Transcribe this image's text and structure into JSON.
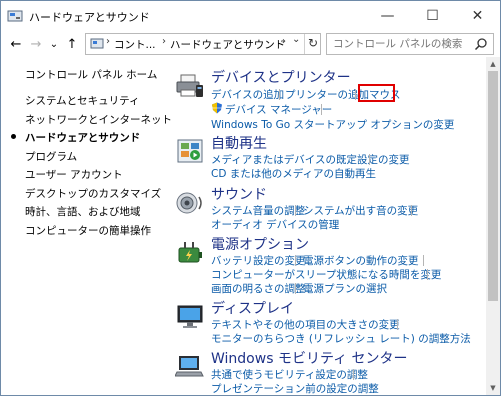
{
  "window": {
    "title": "ハードウェアとサウンド",
    "minimize_glyph": "—",
    "maximize_glyph": "☐",
    "close_glyph": "✕"
  },
  "nav": {
    "back_glyph": "←",
    "forward_glyph": "→",
    "recent_glyph": "⌄",
    "up_glyph": "↑",
    "refresh_glyph": "↻",
    "dropdown_glyph": "⌄"
  },
  "address": {
    "crumbs": [
      "コント...",
      "ハードウェアとサウンド"
    ],
    "separator": "›"
  },
  "search": {
    "placeholder": "コントロール パネルの検索"
  },
  "sidebar": {
    "home": "コントロール パネル ホーム",
    "items": [
      {
        "label": "システムとセキュリティ"
      },
      {
        "label": "ネットワークとインターネット"
      },
      {
        "label": "ハードウェアとサウンド",
        "active": true
      },
      {
        "label": "プログラム"
      },
      {
        "label": "ユーザー アカウント"
      },
      {
        "label": "デスクトップのカスタマイズ"
      },
      {
        "label": "時計、言語、および地域"
      },
      {
        "label": "コンピューターの簡単操作"
      }
    ]
  },
  "categories": {
    "devices": {
      "title": "デバイスとプリンター",
      "links": [
        "デバイスの追加",
        "プリンターの追加",
        "マウス",
        "デバイス マネージャー",
        "Windows To Go スタートアップ オプションの変更"
      ]
    },
    "autoplay": {
      "title": "自動再生",
      "links": [
        "メディアまたはデバイスの既定設定の変更",
        "CD または他のメディアの自動再生"
      ]
    },
    "sound": {
      "title": "サウンド",
      "links": [
        "システム音量の調整",
        "システムが出す音の変更",
        "オーディオ デバイスの管理"
      ]
    },
    "power": {
      "title": "電源オプション",
      "links": [
        "バッテリ設定の変更",
        "電源ボタンの動作の変更",
        "コンピューターがスリープ状態になる時間を変更",
        "画面の明るさの調整",
        "電源プランの選択"
      ]
    },
    "display": {
      "title": "ディスプレイ",
      "links": [
        "テキストやその他の項目の大きさの変更",
        "モニターのちらつき (リフレッシュ レート) の調整方法"
      ]
    },
    "mobility": {
      "title": "Windows モビリティ センター",
      "links": [
        "共通で使うモビリティ設定の調整",
        "プレゼンテーション前の設定の調整"
      ]
    }
  },
  "colors": {
    "link": "#0b5ba8",
    "category_title": "#1e3287",
    "highlight": "#e00000"
  },
  "icons": [
    "control-panel-icon",
    "printer-icon",
    "autoplay-icon",
    "speaker-icon",
    "power-icon",
    "monitor-icon",
    "mobility-icon",
    "shield-icon",
    "search-icon"
  ]
}
